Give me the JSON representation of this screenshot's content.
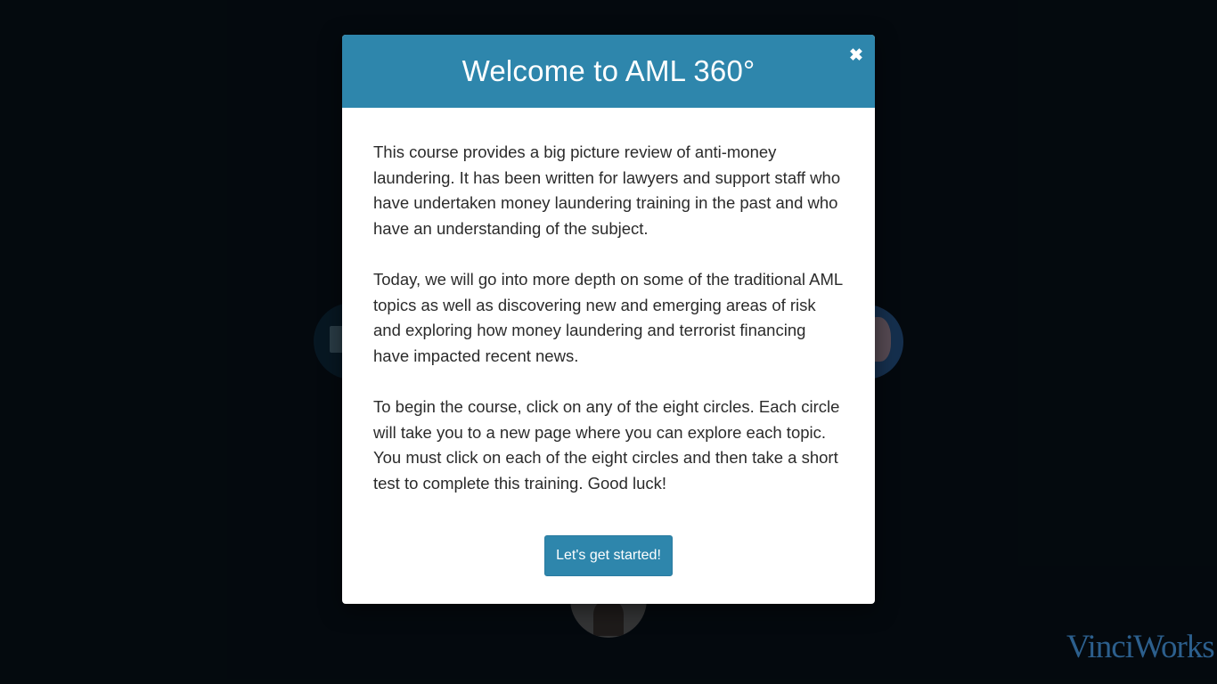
{
  "modal": {
    "title": "Welcome to AML 360°",
    "close_symbol": "✖",
    "paragraphs": [
      "This course provides a big picture review of anti-money laundering. It has been written for lawyers and support staff who have undertaken money laundering training in the past and who have an understanding of the subject.",
      "Today, we will go into more depth on some of the traditional AML topics as well as discovering new and emerging areas of risk and exploring how money laundering and terrorist financing have impacted recent news.",
      "To begin the course, click on any of the eight circles. Each circle will take you to a new page where you can explore each topic. You must click on each of the eight circles and then take a short test to complete this training. Good luck!"
    ],
    "start_button_label": "Let's get started!"
  },
  "branding": {
    "logo_text": "VinciWorks"
  },
  "colors": {
    "accent": "#2e86ac",
    "background": "#050c11",
    "logo": "#2c5f8d"
  },
  "icons": {
    "close": "close-icon",
    "topic_circles": [
      "book-icon",
      "profile-icon",
      "person-icon"
    ]
  }
}
